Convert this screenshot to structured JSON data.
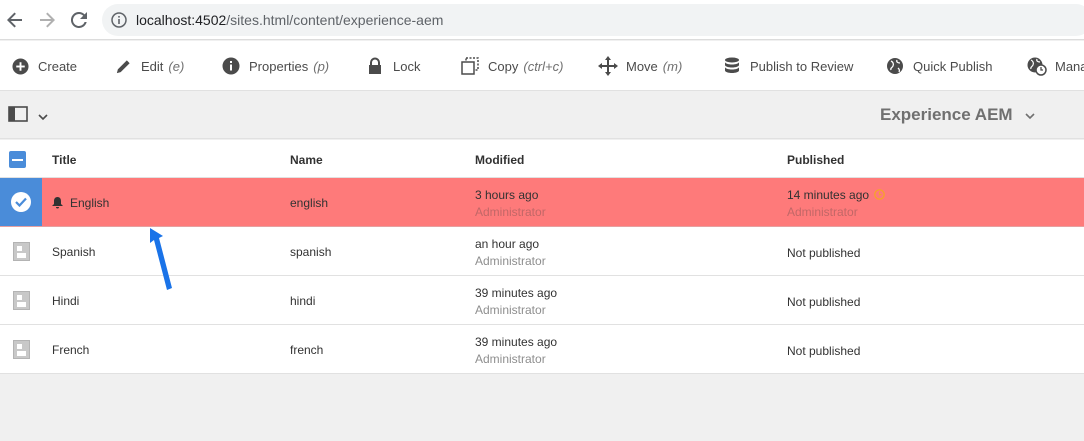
{
  "browser": {
    "url_host": "localhost:4502",
    "url_path": "/sites.html/content/experience-aem"
  },
  "actions": [
    {
      "id": "create",
      "label": "Create",
      "shortcut": "",
      "icon": "plus-circle-icon"
    },
    {
      "id": "edit",
      "label": "Edit",
      "shortcut": "(e)",
      "icon": "pencil-icon"
    },
    {
      "id": "properties",
      "label": "Properties",
      "shortcut": "(p)",
      "icon": "info-icon"
    },
    {
      "id": "lock",
      "label": "Lock",
      "shortcut": "",
      "icon": "lock-icon"
    },
    {
      "id": "copy",
      "label": "Copy",
      "shortcut": "(ctrl+c)",
      "icon": "copy-icon"
    },
    {
      "id": "move",
      "label": "Move",
      "shortcut": "(m)",
      "icon": "move-icon"
    },
    {
      "id": "publish_review",
      "label": "Publish to Review",
      "shortcut": "",
      "icon": "database-icon"
    },
    {
      "id": "quick_publish",
      "label": "Quick Publish",
      "shortcut": "",
      "icon": "globe-icon"
    },
    {
      "id": "manage",
      "label": "Mana",
      "shortcut": "",
      "icon": "globe-clock-icon"
    }
  ],
  "header": {
    "title": "Experience AEM"
  },
  "table": {
    "columns": [
      "Title",
      "Name",
      "Modified",
      "Published"
    ],
    "rows": [
      {
        "title": "English",
        "name": "english",
        "modified": "3 hours ago",
        "modified_by": "Administrator",
        "published": "14 minutes ago",
        "published_by": "Administrator",
        "selected": true
      },
      {
        "title": "Spanish",
        "name": "spanish",
        "modified": "an hour ago",
        "modified_by": "Administrator",
        "published": "Not published",
        "published_by": "",
        "selected": false
      },
      {
        "title": "Hindi",
        "name": "hindi",
        "modified": "39 minutes ago",
        "modified_by": "Administrator",
        "published": "Not published",
        "published_by": "",
        "selected": false
      },
      {
        "title": "French",
        "name": "french",
        "modified": "39 minutes ago",
        "modified_by": "Administrator",
        "published": "Not published",
        "published_by": "",
        "selected": false
      }
    ]
  },
  "colors": {
    "selected_row": "#fe7a7a",
    "accent_blue": "#4a8cd9",
    "annotation_arrow": "#1a73e8",
    "pending_clock": "#f5a623"
  }
}
